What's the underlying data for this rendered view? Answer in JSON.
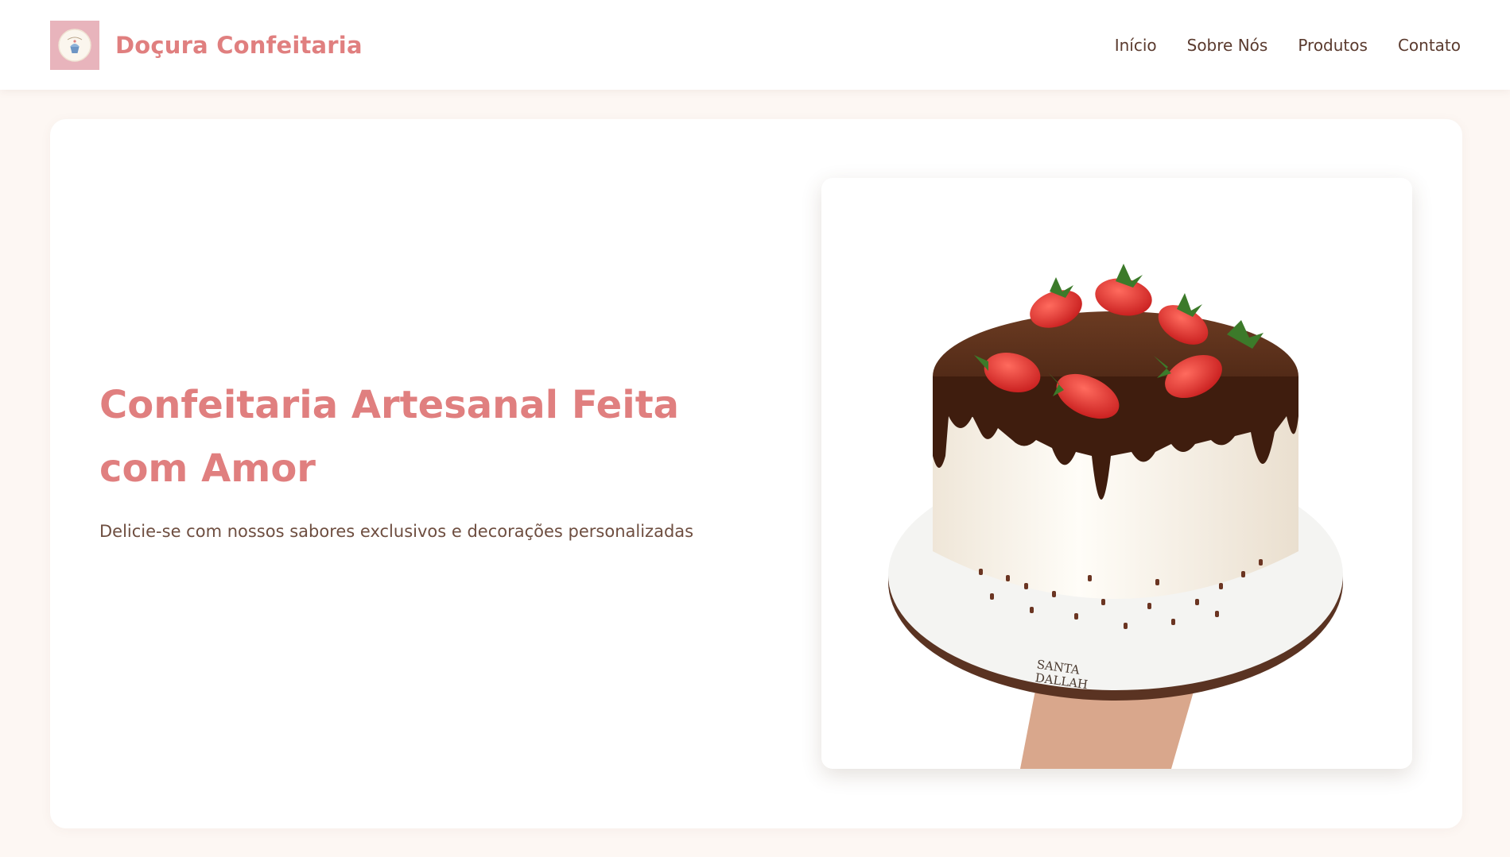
{
  "header": {
    "brand_name": "Doçura Confeitaria",
    "logo_icon": "cupcake-icon",
    "nav": [
      {
        "label": "Início"
      },
      {
        "label": "Sobre Nós"
      },
      {
        "label": "Produtos"
      },
      {
        "label": "Contato"
      }
    ]
  },
  "hero": {
    "title": "Confeitaria Artesanal Feita com Amor",
    "subtitle": "Delicie-se com nossos sabores exclusivos e decorações personalizadas",
    "image_icon": "cake-photo",
    "plate_text_line1": "SANTA",
    "plate_text_line2": "DALLAH"
  },
  "colors": {
    "accent": "#e07f7f",
    "logo_bg": "#e8b4bc",
    "text_brown": "#5a3a2e",
    "page_bg": "#fdf7f3"
  }
}
